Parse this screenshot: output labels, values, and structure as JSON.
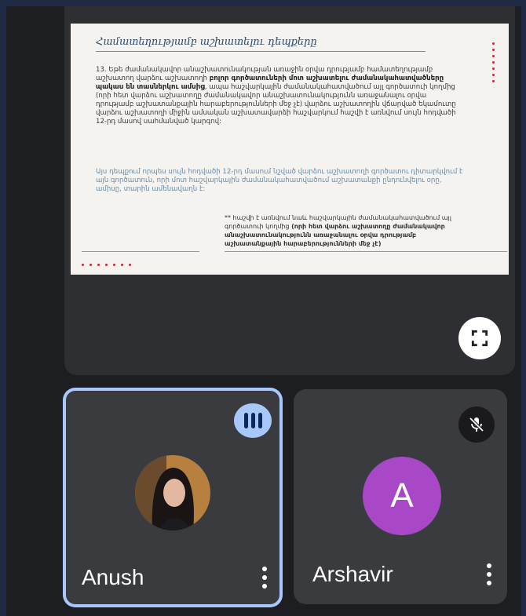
{
  "slide": {
    "title": "Համատեղությամբ աշխատելու դեպքերը",
    "paragraph_start": "13. Եթե ժամանակավոր անաշխատունակության առաջին օրվա դրությամբ համատեղությամբ աշխատող վարձու աշխատողի ",
    "paragraph_bold": "բոլոր գործատուների մոտ աշխատելու ժամանակահատվածները պակաս են տասներկու ամսից",
    "paragraph_end": ", ապա հաշվարկային ժամանակահատվածում այլ գործատուի կողմից (որի հետ վարձու աշխատողը ժամանակավոր անաշխատունակությունն առաջանալու օրվա դրությամբ աշխատանքային հարաբերությունների մեջ չէ) վարձու աշխատողին վճարված եկամուտը վարձու աշխատողի միջին ամսական աշխատավարձի հաշվարկում հաշվի է առնվում սույն հոդվածի 12-րդ մասով սահմանված կարգով:",
    "note": "Այս դեպքում որպես սույն հոդվածի 12-րդ մասում նշված վարձու աշխատողի գործատու դիտարկվում է այն գործատուն, որի մոտ հաշվարկային ժամանակահատվածում աշխատանքի ընդունվելու օրը, ամիսը, տարին ամենավաղն է:",
    "footnote_start": "** հաշվի է առնվում նաև հաշվարկային ժամանակահատվածում այլ գործատուի կողմից ",
    "footnote_bold": "(որի հետ վարձու աշխատողը ժամանակավոր անաշխատունակությունն առաջանալու օրվա դրությամբ աշխատանքային հարաբերությունների մեջ չէ)"
  },
  "participants": [
    {
      "name": "Anush",
      "speaking": true
    },
    {
      "name": "Arshavir",
      "initial": "A",
      "muted": true
    }
  ],
  "colors": {
    "speaking_ring": "#a8c7fa",
    "avatar_purple": "#a848c6",
    "slide_accent": "#d8203a"
  },
  "icons": {
    "fullscreen": "fullscreen-icon",
    "speaking": "audio-bars-icon",
    "mic_off": "mic-off-icon",
    "more": "more-vert-icon"
  }
}
